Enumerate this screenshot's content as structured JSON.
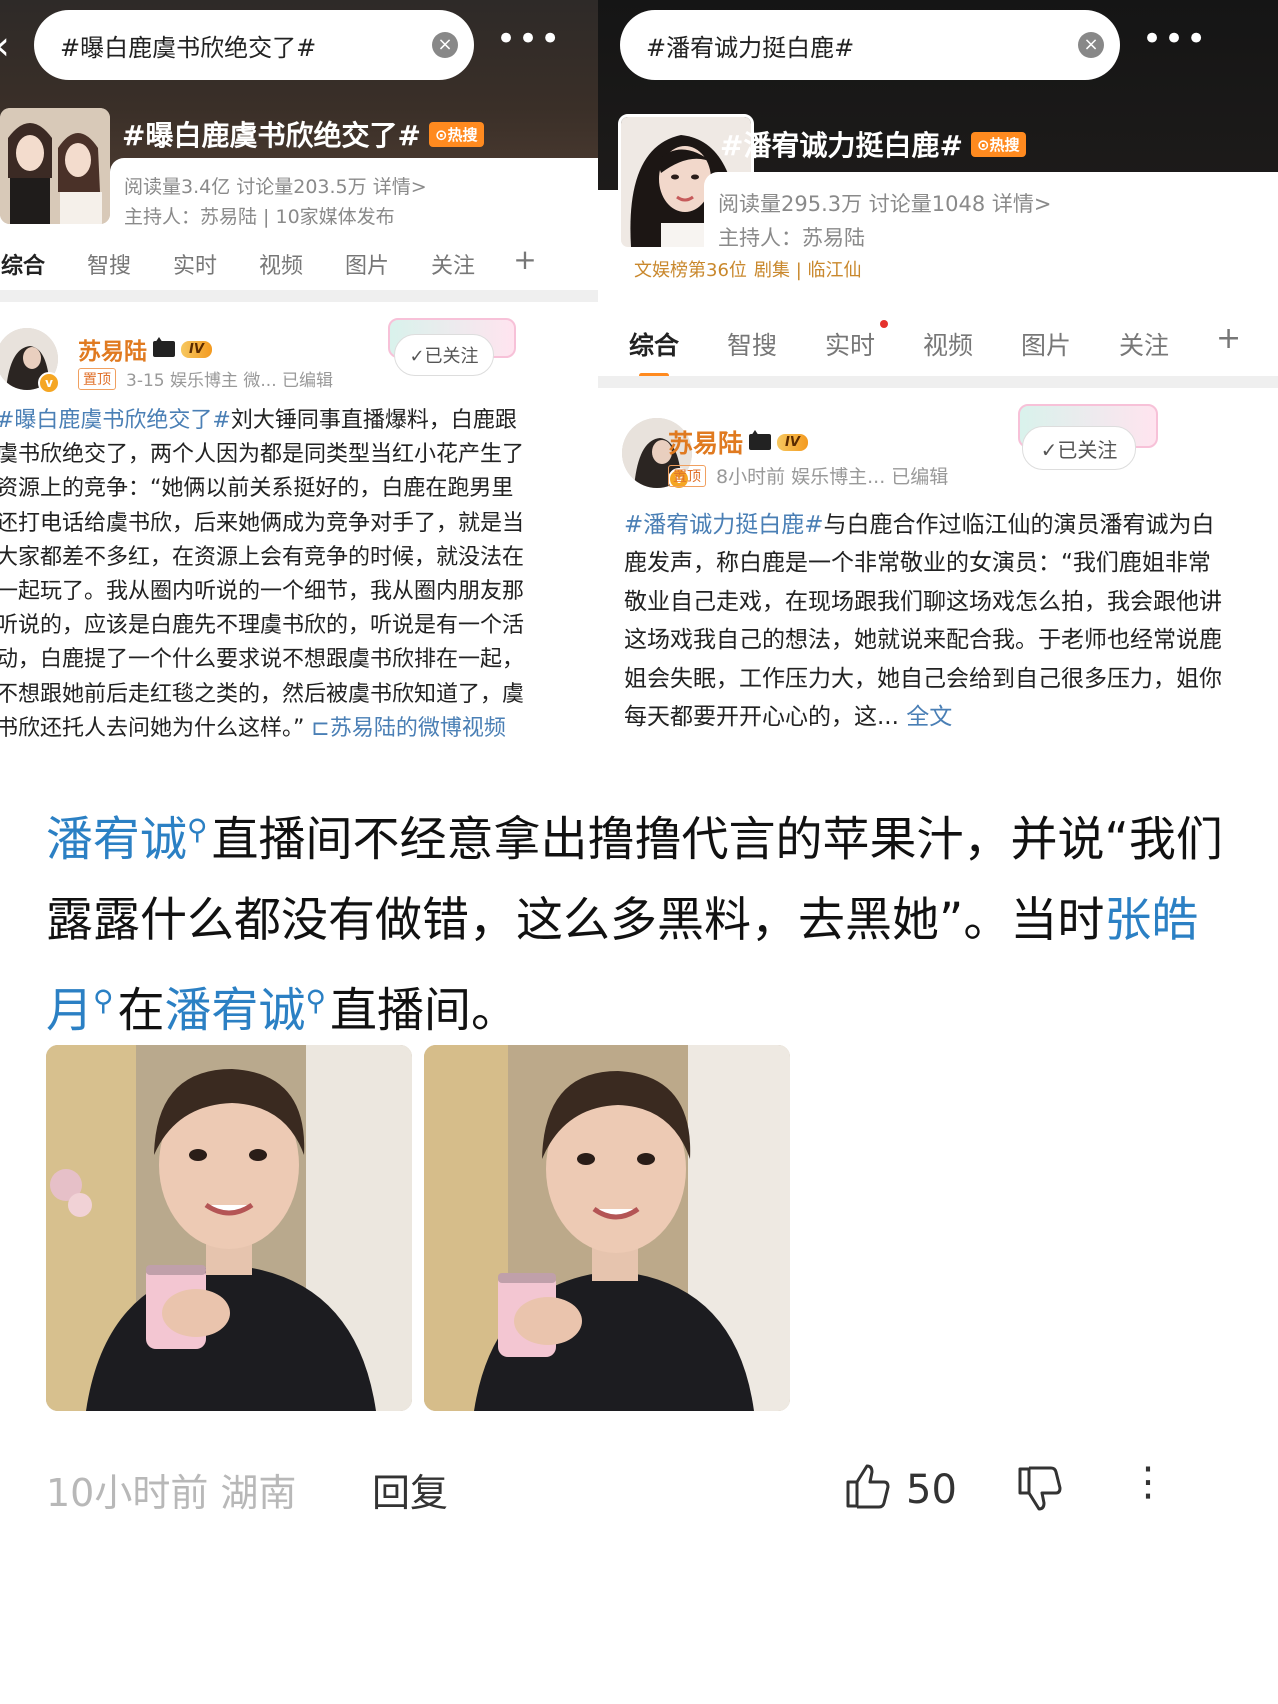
{
  "left": {
    "search_text": "#曝白鹿虞书欣绝交了#",
    "topic_title": "#曝白鹿虞书欣绝交了#",
    "hot_badge": "热搜",
    "stats": "阅读量3.4亿  讨论量203.5万  详情>",
    "host": "主持人：苏易陆 | 10家媒体发布",
    "tabs": [
      "综合",
      "智搜",
      "实时",
      "视频",
      "图片",
      "关注"
    ],
    "tab_add": "+",
    "author": "苏易陆",
    "level": "IV",
    "pin": "置顶",
    "meta": "3-15  娱乐博主 微...  已编辑",
    "follow": "✓已关注",
    "post_hashtag": "#曝白鹿虞书欣绝交了#",
    "post_body": "刘大锤同事直播爆料，白鹿跟虞书欣绝交了，两个人因为都是同类型当红小花产生了资源上的竞争：“她俩以前关系挺好的，白鹿在跑男里还打电话给虞书欣，后来她俩成为竞争对手了，就是当大家都差不多红，在资源上会有竞争的时候，就没法在一起玩了。我从圈内听说的一个细节，我从圈内朋友那听说的，应该是白鹿先不理虞书欣的，听说是有一个活动，白鹿提了一个什么要求说不想跟虞书欣排在一起，不想跟她前后走红毯之类的，然后被虞书欣知道了，虞书欣还托人去问她为什么这样。”",
    "post_link": "⊏苏易陆的微博视频"
  },
  "right": {
    "search_text": "#潘宥诚力挺白鹿#",
    "topic_title": "#潘宥诚力挺白鹿#",
    "hot_badge": "热搜",
    "stats": "阅读量295.3万  讨论量1048  详情>",
    "host": "主持人：苏易陆",
    "rank": "文娱榜第36位",
    "drama": "剧集 | 临江仙",
    "tabs": [
      "综合",
      "智搜",
      "实时",
      "视频",
      "图片",
      "关注"
    ],
    "tab_add": "+",
    "author": "苏易陆",
    "level": "IV",
    "pin": "置顶",
    "meta": "8小时前  娱乐博主...  已编辑",
    "follow": "✓已关注",
    "post_hashtag": "#潘宥诚力挺白鹿#",
    "post_body": "与白鹿合作过临江仙的演员潘宥诚为白鹿发声，称白鹿是一个非常敬业的女演员：“我们鹿姐非常敬业自己走戏，在现场跟我们聊这场戏怎么拍，我会跟他讲这场戏我自己的想法，她就说来配合我。于老师也经常说鹿姐会失眠，工作压力大，她自己会给到自己很多压力，姐你每天都要开开心心的，这...",
    "post_fulltext": "全文"
  },
  "comment": {
    "kw1": "潘宥诚",
    "part1": "直播间不经意拿出撸撸代言的苹果汁，并说“我们露露什么都没有做错，这么多黑料，去黑她”。当时",
    "kw2": "张皓月",
    "part2": "在",
    "kw3": "潘宥诚",
    "part3": "直播间。",
    "time_location": "10小时前 湖南",
    "reply": "回复",
    "likes": "50"
  },
  "colors": {
    "accent_orange": "#ff8a1f",
    "link_blue": "#2b80c4",
    "username_orange": "#e07a20"
  },
  "icons": [
    "back-arrow-icon",
    "clear-icon",
    "more-icon",
    "thumbs-up-icon",
    "thumbs-down-icon",
    "vertical-more-icon"
  ]
}
